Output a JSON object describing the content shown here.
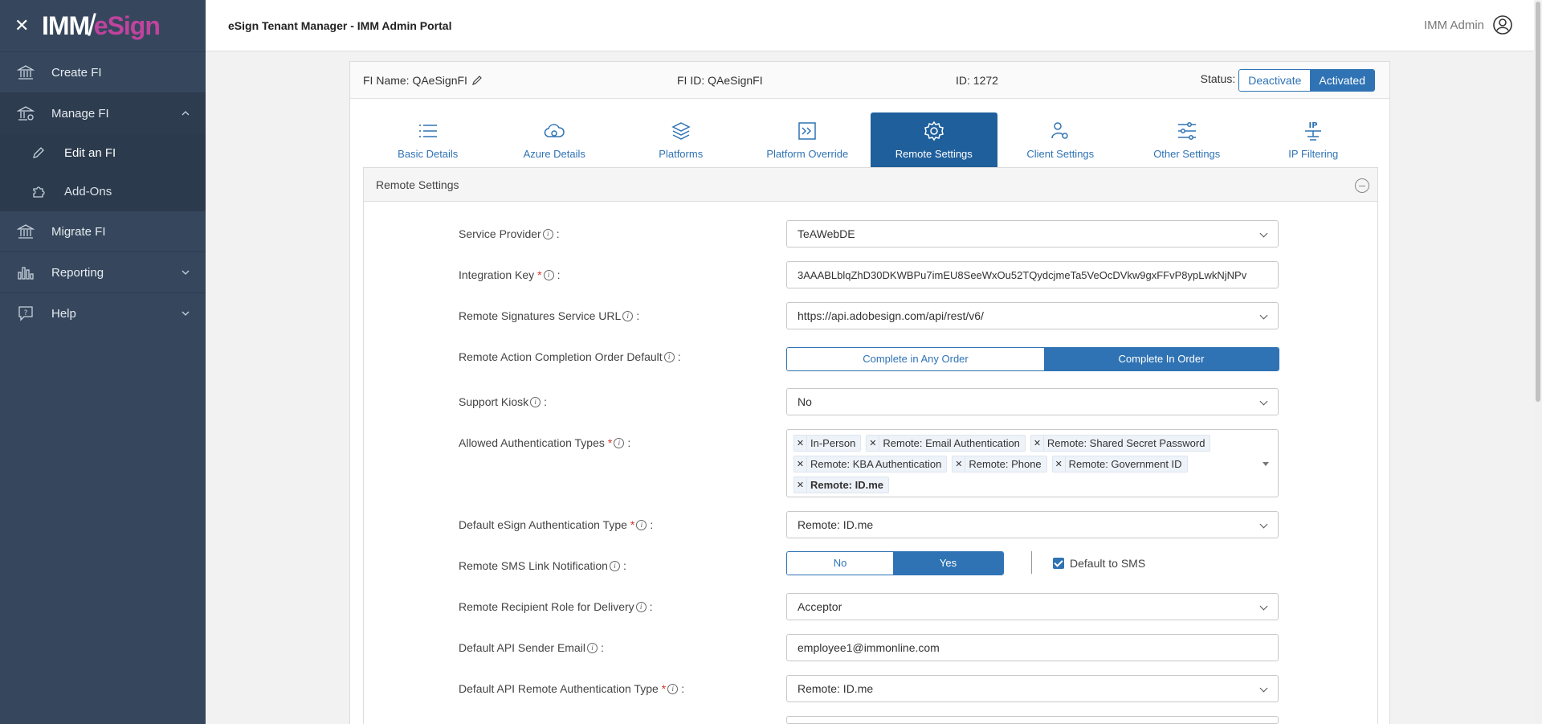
{
  "app": {
    "logo_imm": "IMM",
    "logo_esign": "eSign",
    "title": "eSign Tenant Manager - IMM Admin Portal",
    "user": "IMM Admin"
  },
  "sidebar": {
    "items": [
      {
        "label": "Create FI"
      },
      {
        "label": "Manage FI"
      },
      {
        "label": "Edit an FI"
      },
      {
        "label": "Add-Ons"
      },
      {
        "label": "Migrate FI"
      },
      {
        "label": "Reporting"
      },
      {
        "label": "Help"
      }
    ]
  },
  "fi": {
    "name": "FI Name: QAeSignFI",
    "fi_id": "FI ID: QAeSignFI",
    "id": "ID: 1272",
    "status_label": "Status:",
    "deactivate": "Deactivate",
    "activated": "Activated"
  },
  "tabs": [
    {
      "label": "Basic Details"
    },
    {
      "label": "Azure Details"
    },
    {
      "label": "Platforms"
    },
    {
      "label": "Platform Override"
    },
    {
      "label": "Remote Settings"
    },
    {
      "label": "Client Settings"
    },
    {
      "label": "Other Settings"
    },
    {
      "label": "IP Filtering"
    }
  ],
  "section": {
    "title": "Remote Settings"
  },
  "form": {
    "service_provider": {
      "label": "Service Provider",
      "value": "TeAWebDE"
    },
    "integration_key": {
      "label": "Integration Key",
      "value": "3AAABLblqZhD30DKWBPu7imEU8SeeWxOu52TQydcjmeTa5VeOcDVkw9gxFFvP8ypLwkNjNPv"
    },
    "remote_sig_url": {
      "label": "Remote Signatures Service URL",
      "value": "https://api.adobesign.com/api/rest/v6/"
    },
    "completion_order": {
      "label": "Remote Action Completion Order Default",
      "opt_any": "Complete in Any Order",
      "opt_order": "Complete In Order"
    },
    "support_kiosk": {
      "label": "Support Kiosk",
      "value": "No"
    },
    "auth_types": {
      "label": "Allowed Authentication Types",
      "chips": [
        "In-Person",
        "Remote: Email Authentication",
        "Remote: Shared Secret Password",
        "Remote: KBA Authentication",
        "Remote: Phone",
        "Remote: Government ID",
        "Remote: ID.me"
      ]
    },
    "default_auth": {
      "label": "Default eSign Authentication Type",
      "value": "Remote: ID.me"
    },
    "sms_link": {
      "label": "Remote SMS Link Notification",
      "no": "No",
      "yes": "Yes",
      "default_sms": "Default to SMS"
    },
    "recipient_role": {
      "label": "Remote Recipient Role for Delivery",
      "value": "Acceptor"
    },
    "sender_email": {
      "label": "Default API Sender Email",
      "value": "employee1@immonline.com"
    },
    "api_auth": {
      "label": "Default API Remote Authentication Type",
      "value": "Remote: ID.me"
    }
  },
  "colors": {
    "sidebar_bg": "#36475d",
    "accent": "#2f73b4",
    "active_tab": "#1f5f9c",
    "brand_pink": "#c0439e"
  }
}
